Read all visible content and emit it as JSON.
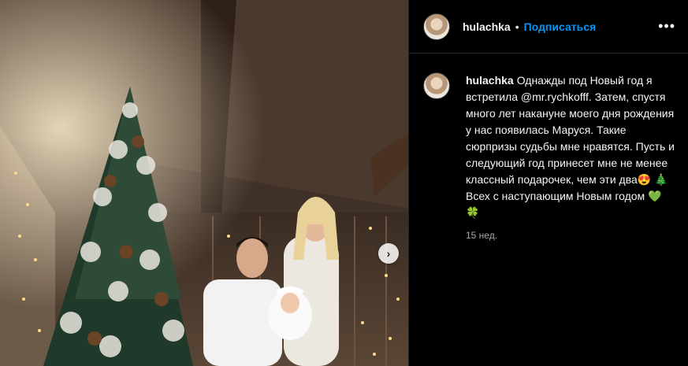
{
  "post": {
    "username": "hulachka",
    "dot": "•",
    "follow_label": "Подписаться",
    "more_label": "•••",
    "caption": "Однажды под Новый год я встретила @mr.rychkofff. Затем, спустя много лет накануне моего дня рождения у нас появилась Маруся. Такие сюрпризы судьбы мне нравятся. Пусть и следующий год принесет мне не менее классный подарочек, чем эти два😍 🎄 Всех с наступающим Новым годом 💚 🍀",
    "time": "15 нед.",
    "next_label": "›"
  },
  "colors": {
    "background": "#000000",
    "link": "#0095f6",
    "secondary_text": "#a8a8a8"
  }
}
